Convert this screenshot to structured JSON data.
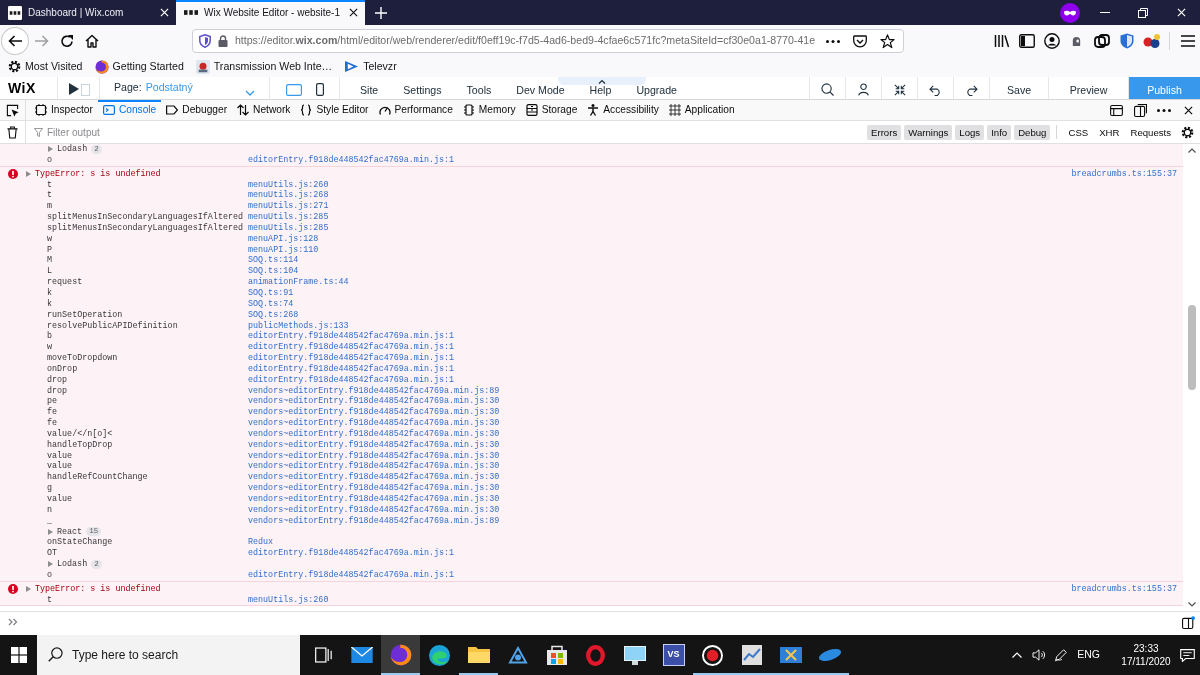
{
  "browser": {
    "tabs": [
      {
        "title": "Dashboard | Wix.com",
        "selected": false
      },
      {
        "title": "Wix Website Editor - website-1",
        "selected": true
      }
    ],
    "url": "https://editor.**wix.com**/html/editor/web/renderer/edit/f0eff19c-f7d5-4ad6-bed9-4cfae6c571fc?metaSiteId=cf30e0a1-8770-41e",
    "bookmarks": [
      {
        "kind": "gear",
        "label": "Most Visited"
      },
      {
        "kind": "firefox",
        "label": "Getting Started"
      },
      {
        "kind": "transmission",
        "label": "Transmission Web Inte…"
      },
      {
        "kind": "televzr",
        "label": "Televzr"
      }
    ]
  },
  "editor": {
    "logo": "WiX",
    "page_label": "Page:",
    "page_name": "Podstatný",
    "menus": [
      "Site",
      "Settings",
      "Tools",
      "Dev Mode",
      "Help",
      "Upgrade"
    ],
    "actions": [
      "Save",
      "Preview"
    ],
    "publish": "Publish"
  },
  "devtools": {
    "tabs": [
      {
        "label": "Inspector",
        "selected": false
      },
      {
        "label": "Console",
        "selected": true
      },
      {
        "label": "Debugger",
        "selected": false
      },
      {
        "label": "Network",
        "selected": false
      },
      {
        "label": "Style Editor",
        "selected": false
      },
      {
        "label": "Performance",
        "selected": false
      },
      {
        "label": "Memory",
        "selected": false
      },
      {
        "label": "Storage",
        "selected": false
      },
      {
        "label": "Accessibility",
        "selected": false
      },
      {
        "label": "Application",
        "selected": false
      }
    ],
    "filter": {
      "placeholder": "Filter output"
    },
    "severity_filters": [
      {
        "label": "Errors",
        "selected": true
      },
      {
        "label": "Warnings",
        "selected": true
      },
      {
        "label": "Logs",
        "selected": true
      },
      {
        "label": "Info",
        "selected": true
      },
      {
        "label": "Debug",
        "selected": true
      }
    ],
    "type_filters": [
      {
        "label": "CSS",
        "selected": false
      },
      {
        "label": "XHR",
        "selected": false
      },
      {
        "label": "Requests",
        "selected": false
      }
    ]
  },
  "console": {
    "messages": [
      {
        "kind": "error",
        "frames": [
          {
            "kind": "group",
            "label": "Lodash",
            "count": "2"
          },
          {
            "kind": "frame",
            "function": "o",
            "location": "editorEntry.f918de448542fac4769a.min.js:1"
          }
        ]
      },
      {
        "kind": "error",
        "text": "TypeError: s is undefined",
        "location": "breadcrumbs.ts:155:37",
        "frames": [
          {
            "kind": "frame",
            "function": "t",
            "location": "menuUtils.js:260"
          },
          {
            "kind": "frame",
            "function": "t",
            "location": "menuUtils.js:268"
          },
          {
            "kind": "frame",
            "function": "m",
            "location": "menuUtils.js:271"
          },
          {
            "kind": "frame",
            "function": "splitMenusInSecondaryLanguagesIfAltered",
            "location": "menuUtils.js:285"
          },
          {
            "kind": "frame",
            "function": "splitMenusInSecondaryLanguagesIfAltered",
            "location": "menuUtils.js:285"
          },
          {
            "kind": "frame",
            "function": "w",
            "location": "menuAPI.js:128"
          },
          {
            "kind": "frame",
            "function": "P",
            "location": "menuAPI.js:110"
          },
          {
            "kind": "frame",
            "function": "M",
            "location": "SOQ.ts:114"
          },
          {
            "kind": "frame",
            "function": "L",
            "location": "SOQ.ts:104"
          },
          {
            "kind": "frame",
            "function": "request",
            "location": "animationFrame.ts:44"
          },
          {
            "kind": "frame",
            "function": "k",
            "location": "SOQ.ts:91"
          },
          {
            "kind": "frame",
            "function": "k",
            "location": "SOQ.ts:74"
          },
          {
            "kind": "frame",
            "function": "runSetOperation",
            "location": "SOQ.ts:268"
          },
          {
            "kind": "frame",
            "function": "resolvePublicAPIDefinition",
            "location": "publicMethods.js:133"
          },
          {
            "kind": "frame",
            "function": "b",
            "location": "editorEntry.f918de448542fac4769a.min.js:1"
          },
          {
            "kind": "frame",
            "function": "w",
            "location": "editorEntry.f918de448542fac4769a.min.js:1"
          },
          {
            "kind": "frame",
            "function": "moveToDropdown",
            "location": "editorEntry.f918de448542fac4769a.min.js:1"
          },
          {
            "kind": "frame",
            "function": "onDrop",
            "location": "editorEntry.f918de448542fac4769a.min.js:1"
          },
          {
            "kind": "frame",
            "function": "drop",
            "location": "editorEntry.f918de448542fac4769a.min.js:1"
          },
          {
            "kind": "frame",
            "function": "drop",
            "location": "vendors~editorEntry.f918de448542fac4769a.min.js:89"
          },
          {
            "kind": "frame",
            "function": "pe",
            "location": "vendors~editorEntry.f918de448542fac4769a.min.js:30"
          },
          {
            "kind": "frame",
            "function": "fe",
            "location": "vendors~editorEntry.f918de448542fac4769a.min.js:30"
          },
          {
            "kind": "frame",
            "function": "fe",
            "location": "vendors~editorEntry.f918de448542fac4769a.min.js:30"
          },
          {
            "kind": "frame",
            "function": "value/</n[o]<",
            "location": "vendors~editorEntry.f918de448542fac4769a.min.js:30"
          },
          {
            "kind": "frame",
            "function": "handleTopDrop",
            "location": "vendors~editorEntry.f918de448542fac4769a.min.js:30"
          },
          {
            "kind": "frame",
            "function": "value",
            "location": "vendors~editorEntry.f918de448542fac4769a.min.js:30"
          },
          {
            "kind": "frame",
            "function": "value",
            "location": "vendors~editorEntry.f918de448542fac4769a.min.js:30"
          },
          {
            "kind": "frame",
            "function": "handleRefCountChange",
            "location": "vendors~editorEntry.f918de448542fac4769a.min.js:30"
          },
          {
            "kind": "frame",
            "function": "g",
            "location": "vendors~editorEntry.f918de448542fac4769a.min.js:30"
          },
          {
            "kind": "frame",
            "function": "value",
            "location": "vendors~editorEntry.f918de448542fac4769a.min.js:30"
          },
          {
            "kind": "frame",
            "function": "n",
            "location": "vendors~editorEntry.f918de448542fac4769a.min.js:30"
          },
          {
            "kind": "frame",
            "function": "_",
            "location": "vendors~editorEntry.f918de448542fac4769a.min.js:89"
          },
          {
            "kind": "group",
            "label": "React",
            "count": "15"
          },
          {
            "kind": "frame",
            "function": "onStateChange",
            "location": "Redux"
          },
          {
            "kind": "frame",
            "function": "OT",
            "location": "editorEntry.f918de448542fac4769a.min.js:1"
          },
          {
            "kind": "group",
            "label": "Lodash",
            "count": "2"
          },
          {
            "kind": "frame",
            "function": "o",
            "location": "editorEntry.f918de448542fac4769a.min.js:1"
          }
        ]
      },
      {
        "kind": "error",
        "text": "TypeError: s is undefined",
        "location": "breadcrumbs.ts:155:37",
        "frames": [
          {
            "kind": "frame",
            "function": "t",
            "location": "menuUtils.js:260"
          }
        ]
      }
    ]
  },
  "taskbar": {
    "search": {
      "placeholder": "Type here to search"
    },
    "apps": [
      {
        "kind": "mail",
        "running": false,
        "selected": false
      },
      {
        "kind": "firefox",
        "running": true,
        "selected": true
      },
      {
        "kind": "edge",
        "running": false,
        "selected": false
      },
      {
        "kind": "explorer",
        "running": true,
        "selected": false
      },
      {
        "kind": "network",
        "running": false,
        "selected": false
      },
      {
        "kind": "store",
        "running": false,
        "selected": false
      },
      {
        "kind": "opera",
        "running": false,
        "selected": false
      },
      {
        "kind": "monitor",
        "running": false,
        "selected": false
      },
      {
        "kind": "vs",
        "label": "VS",
        "running": false,
        "selected": false
      },
      {
        "kind": "record",
        "running": true,
        "selected": false
      },
      {
        "kind": "chart",
        "running": true,
        "selected": false
      },
      {
        "kind": "snipping",
        "running": true,
        "selected": false
      },
      {
        "kind": "disc",
        "running": true,
        "selected": false
      }
    ],
    "language": "ENG",
    "time": "23:33",
    "date": "17/11/2020"
  }
}
